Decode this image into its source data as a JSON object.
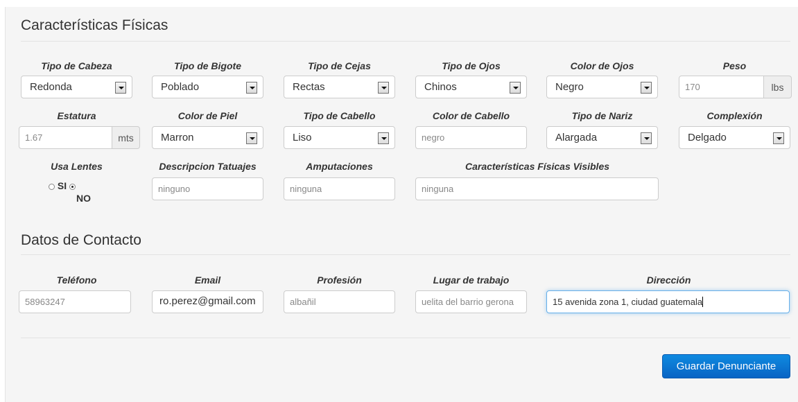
{
  "fisicas": {
    "title": "Características Físicas",
    "fields": {
      "cabeza": {
        "label": "Tipo de Cabeza",
        "value": "Redonda"
      },
      "bigote": {
        "label": "Tipo de Bigote",
        "value": "Poblado"
      },
      "cejas": {
        "label": "Tipo de Cejas",
        "value": "Rectas"
      },
      "ojos": {
        "label": "Tipo de Ojos",
        "value": "Chinos"
      },
      "color_ojos": {
        "label": "Color de Ojos",
        "value": "Negro"
      },
      "peso": {
        "label": "Peso",
        "value": "170",
        "unit": "lbs"
      },
      "estatura": {
        "label": "Estatura",
        "value": "1.67",
        "unit": "mts"
      },
      "piel": {
        "label": "Color de Piel",
        "value": "Marron"
      },
      "cabello": {
        "label": "Tipo de Cabello",
        "value": "Liso"
      },
      "color_cabello": {
        "label": "Color de Cabello",
        "value": "negro"
      },
      "nariz": {
        "label": "Tipo de Nariz",
        "value": "Alargada"
      },
      "complexion": {
        "label": "Complexión",
        "value": "Delgado"
      },
      "lentes": {
        "label": "Usa Lentes",
        "option_si": "SI",
        "option_no": "NO",
        "selected": "NO"
      },
      "tatuajes": {
        "label": "Descripcion Tatuajes",
        "value": "ninguno"
      },
      "amputaciones": {
        "label": "Amputaciones",
        "value": "ninguna"
      },
      "visibles": {
        "label": "Características Físicas Visibles",
        "value": "ninguna"
      }
    }
  },
  "contacto": {
    "title": "Datos de Contacto",
    "fields": {
      "telefono": {
        "label": "Teléfono",
        "value": "58963247"
      },
      "email": {
        "label": "Email",
        "value": "ro.perez@gmail.com"
      },
      "profesion": {
        "label": "Profesión",
        "value": "albañil"
      },
      "trabajo": {
        "label": "Lugar de trabajo",
        "value": "uelita del barrio gerona"
      },
      "direccion": {
        "label": "Dirección",
        "value": "15 avenida zona 1, ciudad guatemala"
      }
    }
  },
  "actions": {
    "save_label": "Guardar Denunciante"
  },
  "colors": {
    "primary_button": "#0b72d1",
    "panel_bg": "#f5f5f5",
    "focus_border": "#66afe9"
  }
}
